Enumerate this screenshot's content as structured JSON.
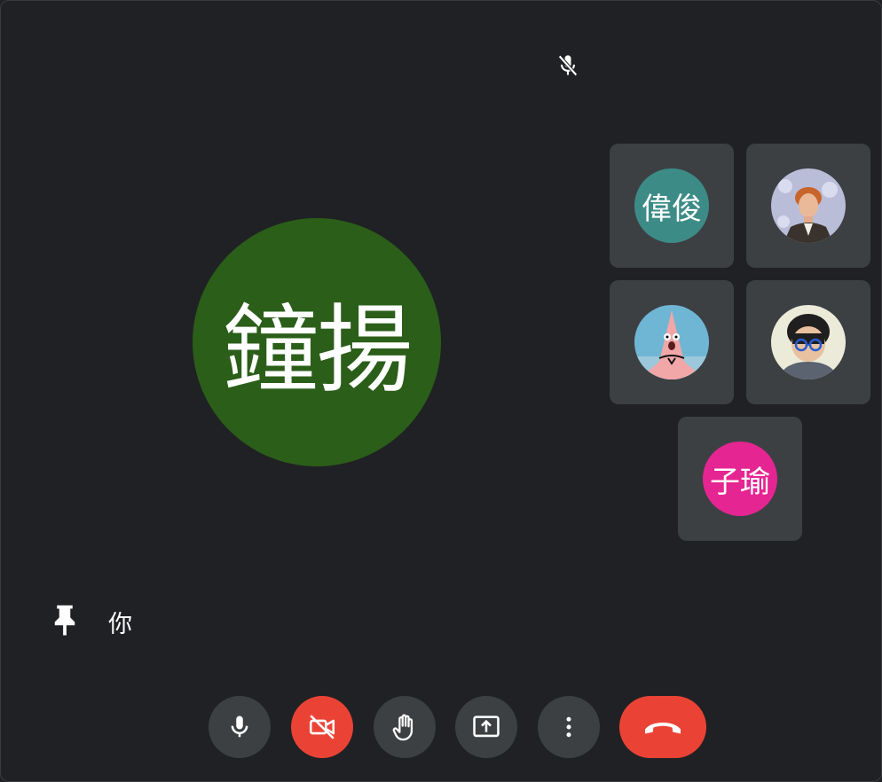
{
  "main_speaker": {
    "initials": "鐘揚",
    "color": "#2b5e19",
    "muted": true
  },
  "participants": [
    {
      "initials": "偉俊",
      "color": "#3d8b86",
      "has_photo": false
    },
    {
      "initials": "",
      "has_photo": true,
      "photo": "man-with-red-hair"
    },
    {
      "initials": "",
      "has_photo": true,
      "photo": "pink-starfish-cartoon"
    },
    {
      "initials": "",
      "has_photo": true,
      "photo": "boy-with-glasses"
    },
    {
      "initials": "子瑜",
      "color": "#e52592",
      "has_photo": false
    }
  ],
  "self": {
    "label": "你"
  },
  "controls": {
    "mic": "microphone-icon",
    "camera": "camera-off-icon",
    "raise_hand": "hand-icon",
    "present": "present-screen-icon",
    "more": "more-vert-icon",
    "hangup": "hangup-icon"
  },
  "colors": {
    "background": "#202124",
    "tile": "#3c4043",
    "danger": "#ea4335"
  }
}
